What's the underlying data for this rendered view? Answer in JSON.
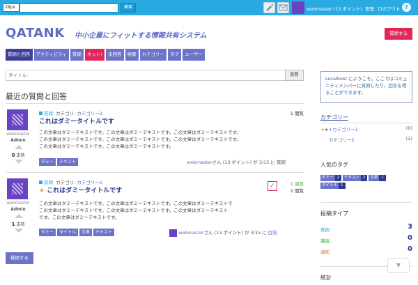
{
  "topbar": {
    "font_size": "28px",
    "search_value": "",
    "search_button": "検索",
    "user": "webmaster (13 ポイント)",
    "manage": "管理",
    "logout": "ログアウト",
    "help": "?"
  },
  "header": {
    "logo": "QATANK",
    "tagline": "中小企業にフィットする情報共有システム",
    "ask_button": "質問する"
  },
  "nav": {
    "tabs": [
      "質問と回答",
      "アクティビティ",
      "質問",
      "ホット!",
      "未回答",
      "懸賞",
      "カテゴリー",
      "タグ",
      "ユーザー"
    ]
  },
  "search": {
    "placeholder": "タイトル:",
    "button": "質問"
  },
  "main": {
    "section_title": "最近の質問と回答",
    "questions": [
      {
        "kind": "質問",
        "category_label": "カテゴリ:",
        "category": "カテゴリー2",
        "title": "これはダミータイトルです",
        "starred": false,
        "user": "webmaster",
        "role": "Admin",
        "votes": "0",
        "votes_label": "支持",
        "body": [
          "この文章はダミーテキストです。この文章はダミーテキストです。この文章はダミーテキストです。",
          "この文章はダミーテキストです。この文章はダミーテキストです。この文章はダミーテキストです。",
          "この文章はダミーテキストです。この文章はダミーテキストです。"
        ],
        "tags": [
          "ダミー",
          "テキスト"
        ],
        "views": "1 閲覧",
        "answers": "",
        "byline_user": "webmaster",
        "byline_rest": "さん (13 ポイント) が 3/15 に",
        "byline_action": "質問"
      },
      {
        "kind": "質問",
        "category_label": "カテゴリ:",
        "category": "カテゴリー2",
        "title": "これはダミータイトルです",
        "starred": true,
        "user": "webmaster",
        "role": "Admin",
        "votes": "1",
        "votes_label": "支持",
        "body": [
          "この文章はダミーテキストです。この文章はダミーテキストです。この文章はダミーテキストで",
          "この文章はダミーテキストです。この文章はダミーテキストです。この文章はダミーテキスト",
          "です。この文章はダミーテキストです。"
        ],
        "tags": [
          "ダミー",
          "タイトル",
          "文章",
          "テキスト"
        ],
        "views": "1 閲覧",
        "answers": "1 回答",
        "byline_user": "webmaster",
        "byline_rest": "さん (13 ポイント) が 3/15 に",
        "byline_action": "回答"
      }
    ],
    "ask_button": "質問する"
  },
  "sidebar": {
    "welcome_pre": "Localhost にようこそ。ここではコミュニティメンバーに",
    "welcome_link": "質問",
    "welcome_mid": "したり、",
    "welcome_link2": "回答",
    "welcome_post": "を得ることができます。",
    "categories_title": "カテゴリー",
    "categories": [
      {
        "name": "★+カテゴリー1",
        "count": "(0)"
      },
      {
        "name": "カテゴリー2",
        "count": "(2)"
      }
    ],
    "tags_title": "人気のタグ",
    "tags": [
      {
        "name": "ダミー",
        "count": "2"
      },
      {
        "name": "テキスト",
        "count": "2"
      },
      {
        "name": "文章",
        "count": "1"
      },
      {
        "name": "タイトル",
        "count": "1"
      }
    ],
    "post_types_title": "投稿タイプ",
    "post_types": [
      {
        "name": "質問",
        "count": "3",
        "color": "#29abe2"
      },
      {
        "name": "議論",
        "count": "0",
        "color": "#3aa83a"
      },
      {
        "name": "通知",
        "count": "0",
        "color": "#e07020"
      }
    ],
    "stats_title": "統計"
  }
}
